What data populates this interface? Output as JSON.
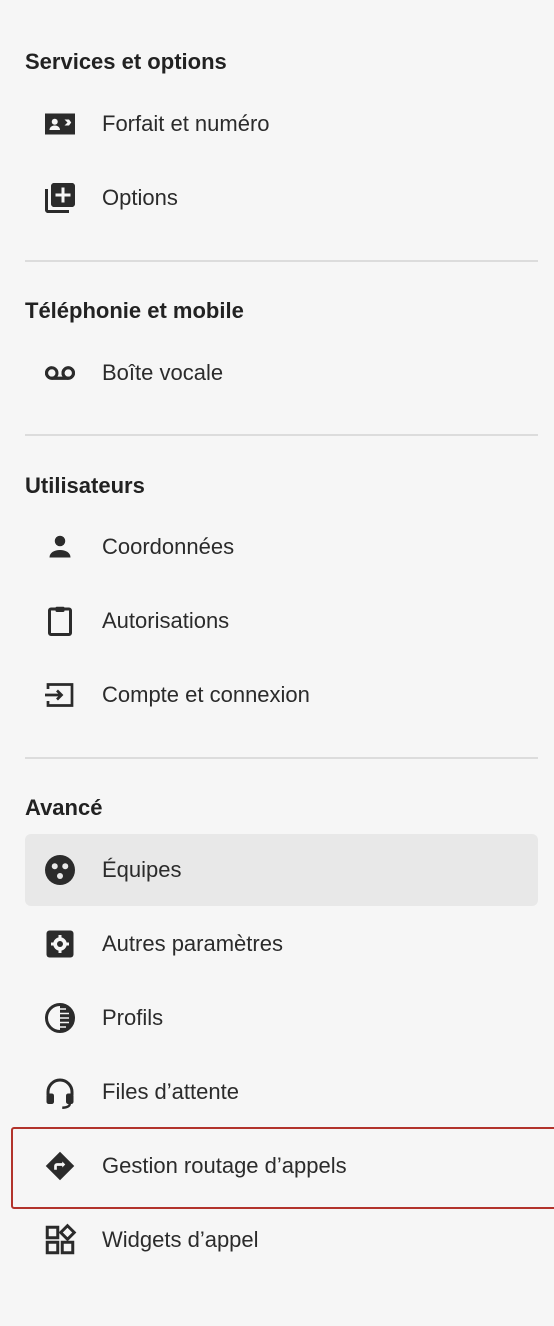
{
  "sections": [
    {
      "title": "Services et options",
      "items": [
        {
          "label": "Forfait et numéro",
          "icon": "contact-card-icon"
        },
        {
          "label": "Options",
          "icon": "library-add-icon"
        }
      ]
    },
    {
      "title": "Téléphonie et mobile",
      "items": [
        {
          "label": "Boîte vocale",
          "icon": "voicemail-icon"
        }
      ]
    },
    {
      "title": "Utilisateurs",
      "items": [
        {
          "label": "Coordonnées",
          "icon": "person-icon"
        },
        {
          "label": "Autorisations",
          "icon": "clipboard-icon"
        },
        {
          "label": "Compte et connexion",
          "icon": "login-icon"
        }
      ]
    },
    {
      "title": "Avancé",
      "items": [
        {
          "label": "Équipes",
          "icon": "team-icon",
          "selected": true
        },
        {
          "label": "Autres paramètres",
          "icon": "settings-box-icon"
        },
        {
          "label": "Profils",
          "icon": "contrast-icon"
        },
        {
          "label": "Files d’attente",
          "icon": "headset-icon"
        },
        {
          "label": "Gestion routage d’appels",
          "icon": "route-diamond-icon",
          "highlighted": true
        },
        {
          "label": "Widgets d’appel",
          "icon": "widgets-icon"
        }
      ]
    }
  ],
  "colors": {
    "background": "#f6f6f6",
    "selected_bg": "#e8e8e8",
    "highlight_border": "#b2332b",
    "divider": "#dcdcdc",
    "icon": "#2b2b2b"
  }
}
